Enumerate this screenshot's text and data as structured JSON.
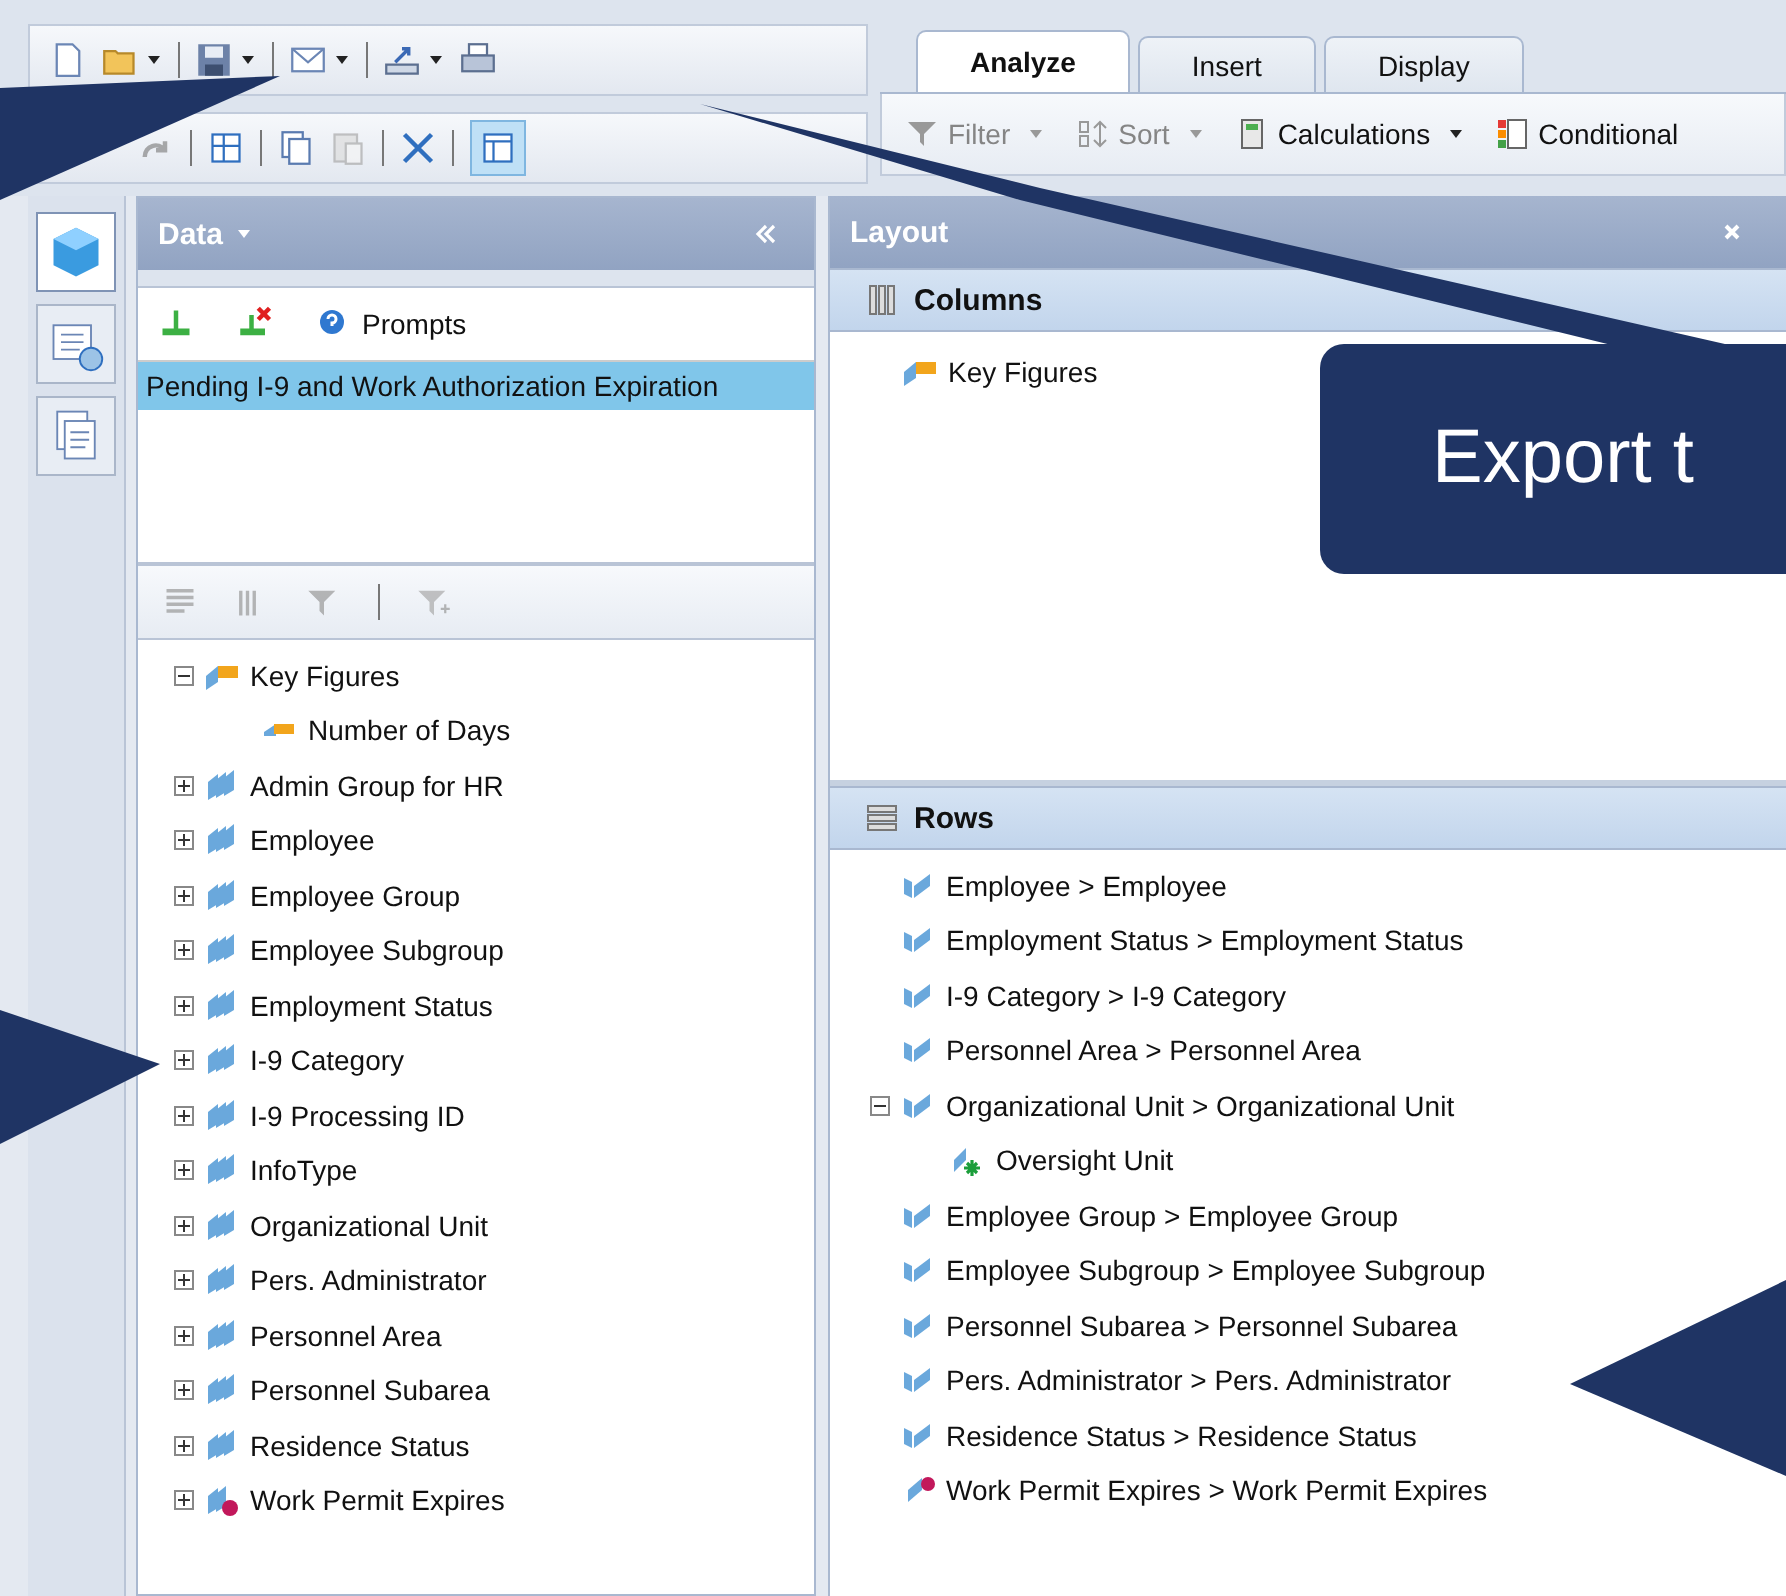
{
  "tabs": [
    {
      "label": "Analyze",
      "selected": true
    },
    {
      "label": "Insert",
      "selected": false
    },
    {
      "label": "Display",
      "selected": false
    }
  ],
  "ribbon": [
    {
      "kind": "filter",
      "label": "Filter",
      "disabled": true,
      "dropdown": true
    },
    {
      "kind": "sort",
      "label": "Sort",
      "disabled": true,
      "dropdown": true
    },
    {
      "kind": "calc",
      "label": "Calculations",
      "disabled": false,
      "dropdown": true
    },
    {
      "kind": "cond",
      "label": "Conditional",
      "disabled": false,
      "dropdown": false
    }
  ],
  "data_panel": {
    "title": "Data",
    "prompts_label": "Prompts",
    "queries": [
      {
        "label": "Pending I-9 and Work Authorization Expiration",
        "selected": true
      }
    ],
    "tree": [
      {
        "kind": "keyfig",
        "label": "Key Figures",
        "expanded": true,
        "children": [
          {
            "kind": "measure",
            "label": "Number of Days"
          }
        ]
      },
      {
        "kind": "dim",
        "label": "Admin Group for HR",
        "expanded": false
      },
      {
        "kind": "dim",
        "label": "Employee",
        "expanded": false
      },
      {
        "kind": "dim",
        "label": "Employee Group",
        "expanded": false
      },
      {
        "kind": "dim",
        "label": "Employee Subgroup",
        "expanded": false
      },
      {
        "kind": "dim",
        "label": "Employment Status",
        "expanded": false
      },
      {
        "kind": "dim",
        "label": "I-9 Category",
        "expanded": false
      },
      {
        "kind": "dim",
        "label": "I-9 Processing ID",
        "expanded": false
      },
      {
        "kind": "dim",
        "label": "InfoType",
        "expanded": false
      },
      {
        "kind": "dim",
        "label": "Organizational Unit",
        "expanded": false
      },
      {
        "kind": "dim",
        "label": "Pers. Administrator",
        "expanded": false
      },
      {
        "kind": "dim",
        "label": "Personnel Area",
        "expanded": false
      },
      {
        "kind": "dim",
        "label": "Personnel Subarea",
        "expanded": false
      },
      {
        "kind": "dim",
        "label": "Residence Status",
        "expanded": false
      },
      {
        "kind": "date",
        "label": "Work Permit Expires",
        "expanded": false
      }
    ]
  },
  "layout_panel": {
    "title": "Layout",
    "columns_title": "Columns",
    "columns": [
      {
        "kind": "keyfig",
        "label": "Key Figures"
      }
    ],
    "rows_title": "Rows",
    "rows": [
      {
        "kind": "dim",
        "label": "Employee > Employee"
      },
      {
        "kind": "dim",
        "label": "Employment Status > Employment Status"
      },
      {
        "kind": "dim",
        "label": "I-9 Category > I-9 Category"
      },
      {
        "kind": "dim",
        "label": "Personnel Area > Personnel Area"
      },
      {
        "kind": "dim",
        "label": "Organizational Unit > Organizational Unit",
        "expanded": true,
        "children": [
          {
            "kind": "hier",
            "label": "Oversight Unit"
          }
        ]
      },
      {
        "kind": "dim",
        "label": "Employee Group > Employee Group"
      },
      {
        "kind": "dim",
        "label": "Employee Subgroup > Employee Subgroup"
      },
      {
        "kind": "dim",
        "label": "Personnel Subarea > Personnel Subarea"
      },
      {
        "kind": "dim",
        "label": "Pers. Administrator > Pers. Administrator"
      },
      {
        "kind": "dim",
        "label": "Residence Status > Residence Status"
      },
      {
        "kind": "date",
        "label": "Work Permit Expires > Work Permit Expires"
      }
    ]
  },
  "callout": {
    "text": "Export t"
  }
}
